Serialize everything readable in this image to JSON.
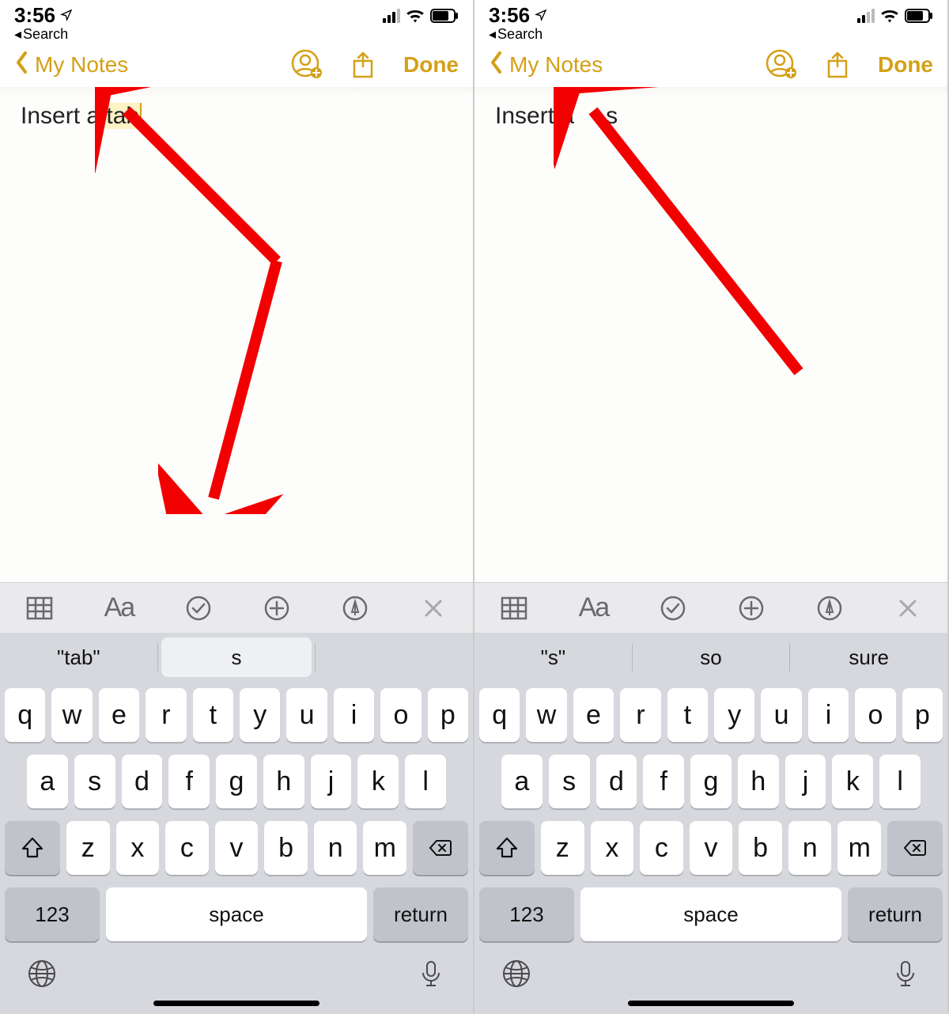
{
  "colors": {
    "accent": "#d4a017",
    "arrow": "#f20000"
  },
  "status": {
    "time": "3:56",
    "back_label": "Search"
  },
  "nav": {
    "back_title": "My Notes",
    "done": "Done"
  },
  "screens": [
    {
      "note_prefix": "Insert a ",
      "note_highlight": "tab",
      "note_suffix": "",
      "use_highlight": true,
      "suggestions": [
        "\"tab\"",
        "s",
        ""
      ],
      "active_suggestion_index": 1
    },
    {
      "note_prefix": "Insert a",
      "note_highlight": "",
      "note_suffix": "s",
      "use_tab_gap": true,
      "suggestions": [
        "\"s\"",
        "so",
        "sure"
      ],
      "active_suggestion_index": -1
    }
  ],
  "format_bar": {
    "Aa_label": "Aa"
  },
  "keyboard": {
    "row1": [
      "q",
      "w",
      "e",
      "r",
      "t",
      "y",
      "u",
      "i",
      "o",
      "p"
    ],
    "row2": [
      "a",
      "s",
      "d",
      "f",
      "g",
      "h",
      "j",
      "k",
      "l"
    ],
    "row3": [
      "z",
      "x",
      "c",
      "v",
      "b",
      "n",
      "m"
    ],
    "numeric": "123",
    "space": "space",
    "ret": "return"
  }
}
